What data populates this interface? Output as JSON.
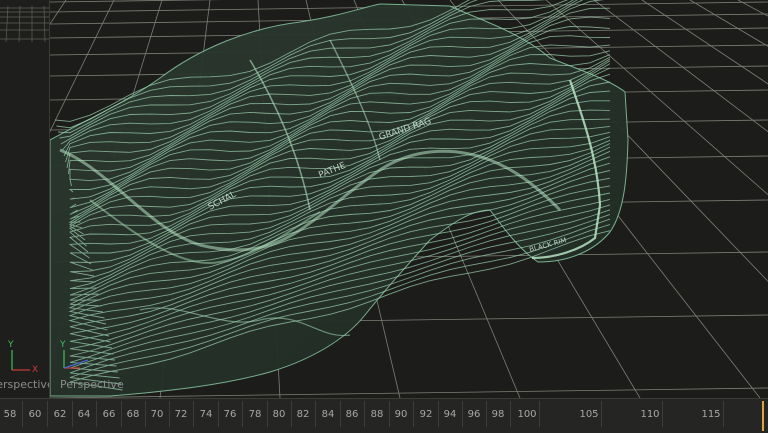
{
  "viewports": {
    "left": {
      "label": "Perspective"
    },
    "main": {
      "label": "Perspective"
    }
  },
  "gizmo": {
    "y_axis": "Y",
    "x_axis": "X"
  },
  "terrain": {
    "annotations": [
      "SCHAL",
      "PATHE",
      "GRAND RAG",
      "BLACK RIM"
    ]
  },
  "timeline": {
    "ticks": [
      "58",
      "60",
      "62",
      "64",
      "66",
      "68",
      "70",
      "72",
      "74",
      "76",
      "78",
      "80",
      "82",
      "84",
      "86",
      "88",
      "90",
      "92",
      "94",
      "96",
      "98",
      "100",
      "105",
      "110",
      "115"
    ]
  },
  "colors": {
    "background": "#1c1d1a",
    "grid": "#9a9c90",
    "terrain": "#9ccfb0",
    "axis_y": "#3fbf5a",
    "axis_x": "#c83b3b",
    "axis_z": "#4668c8",
    "playhead": "#d9a441"
  }
}
